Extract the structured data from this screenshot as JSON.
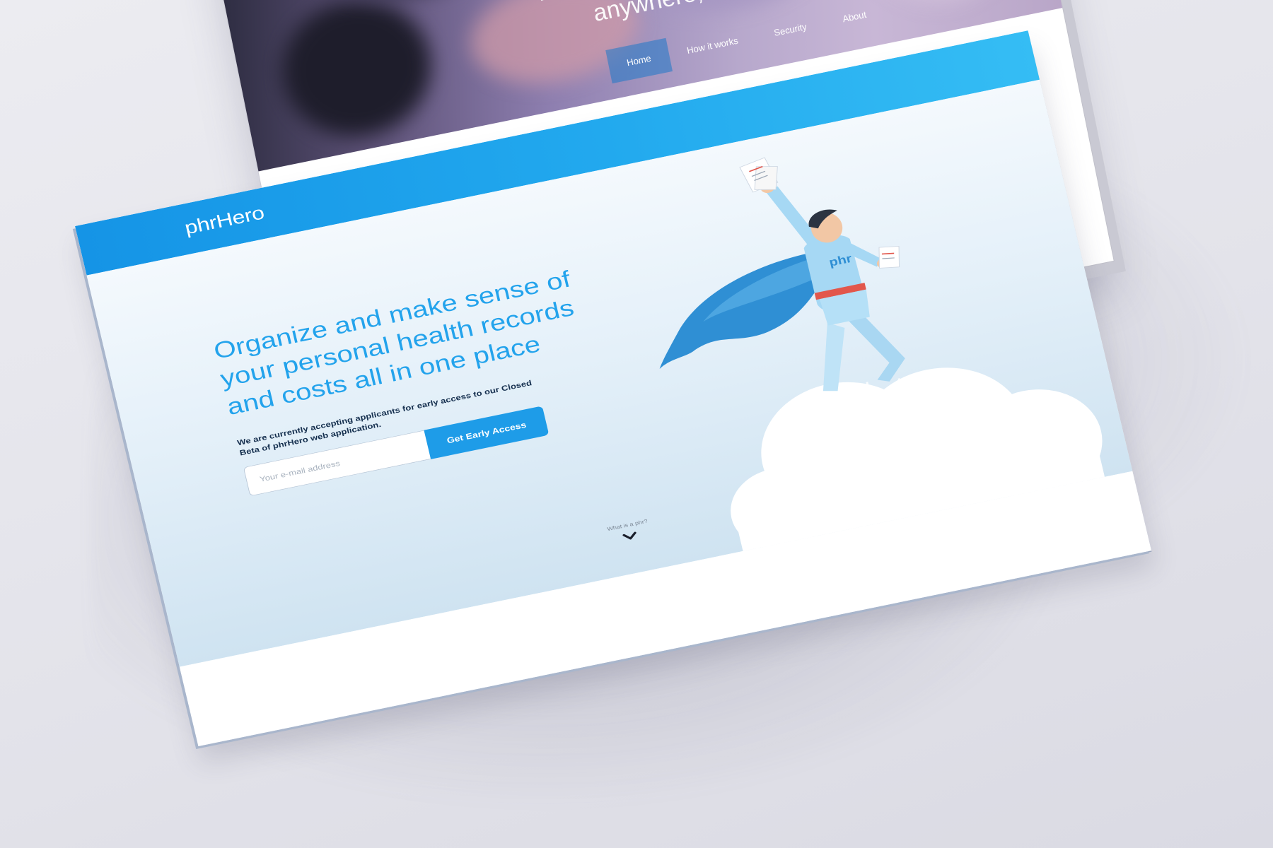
{
  "back_page": {
    "hero_title_line1": "Your personal health record available",
    "hero_title_line2": "anywhere, all in one place.",
    "nav": [
      {
        "label": "Home",
        "active": true
      },
      {
        "label": "How it works",
        "active": false
      },
      {
        "label": "Security",
        "active": false
      },
      {
        "label": "About",
        "active": false
      }
    ]
  },
  "front_page": {
    "logo": "phrHero",
    "headline": "Organize and make sense of your personal health records and costs all in one place",
    "beta_text": "We are currently accepting applicants for early access to our Closed Beta of phrHero web application.",
    "email_placeholder": "Your e-mail address",
    "cta_label": "Get Early Access",
    "scroll_hint": "What is a phr?",
    "hero_badge": "phr"
  },
  "colors": {
    "brand_blue": "#1e9ce8",
    "header_gradient_start": "#1594e6",
    "header_gradient_end": "#35bdf4",
    "headline": "#23a3ec",
    "hero_bg_top": "#f4f9fd",
    "hero_bg_bottom": "#cfe3f1",
    "cape": "#2f8fd4",
    "belt": "#e2574c"
  },
  "icons": [
    "chevron-down-icon",
    "superhero-illustration",
    "cloud-illustration"
  ]
}
